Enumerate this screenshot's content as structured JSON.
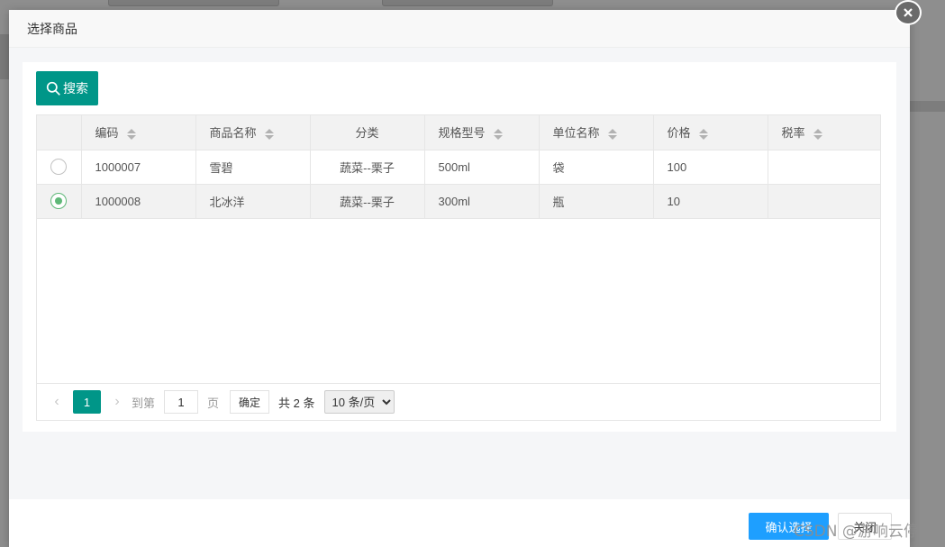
{
  "modal": {
    "title": "选择商品",
    "search_label": "搜索",
    "confirm_label": "确认选择",
    "close_label": "关闭"
  },
  "table": {
    "columns": [
      "编码",
      "商品名称",
      "分类",
      "规格型号",
      "单位名称",
      "价格",
      "税率"
    ],
    "rows": [
      {
        "selected": false,
        "code": "1000007",
        "name": "雪碧",
        "category": "蔬菜--栗子",
        "spec": "500ml",
        "unit": "袋",
        "price": "100",
        "tax": ""
      },
      {
        "selected": true,
        "code": "1000008",
        "name": "北冰洋",
        "category": "蔬菜--栗子",
        "spec": "300ml",
        "unit": "瓶",
        "price": "10",
        "tax": ""
      }
    ]
  },
  "pager": {
    "current": "1",
    "goto_label": "到第",
    "page_value": "1",
    "page_unit": "页",
    "ok_label": "确定",
    "total": "共 2 条",
    "page_size": "10 条/页"
  },
  "watermark": "CSDN @游响云停",
  "colors": {
    "primary": "#009688",
    "confirm": "#1e9fff",
    "radio_checked": "#5fb878"
  }
}
